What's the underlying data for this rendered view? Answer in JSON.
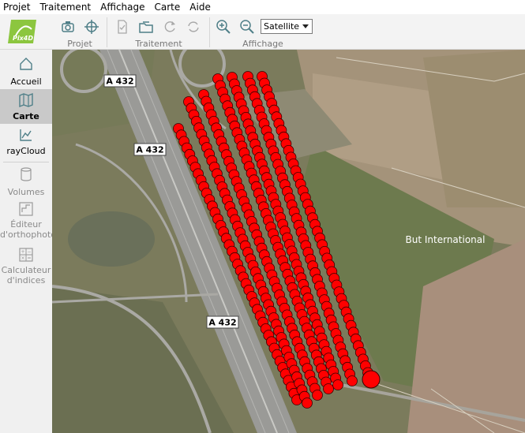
{
  "menu": [
    "Projet",
    "Traitement",
    "Affichage",
    "Carte",
    "Aide"
  ],
  "toolbar": {
    "logo_text": "Pix4D",
    "groups": [
      {
        "label": "Projet"
      },
      {
        "label": "Traitement"
      },
      {
        "label": "Affichage"
      }
    ],
    "basemap_select": "Satellite"
  },
  "sidebar": {
    "items": [
      {
        "label": "Accueil",
        "icon": "home-icon",
        "state": "normal"
      },
      {
        "label": "Carte",
        "icon": "map-icon",
        "state": "active"
      },
      {
        "label": "rayCloud",
        "icon": "raycloud-icon",
        "state": "normal"
      },
      {
        "label": "Volumes",
        "icon": "volumes-icon",
        "state": "disabled"
      },
      {
        "label": "Éditeur d'orthophoto",
        "icon": "ortho-editor-icon",
        "state": "disabled"
      },
      {
        "label": "Calculateur d'indices",
        "icon": "index-calculator-icon",
        "state": "disabled"
      }
    ]
  },
  "map": {
    "road_labels": [
      "A 432",
      "A 432",
      "A 432"
    ],
    "place_label": "But International",
    "marker_color": "#ff0000",
    "flight_lines": 7
  }
}
